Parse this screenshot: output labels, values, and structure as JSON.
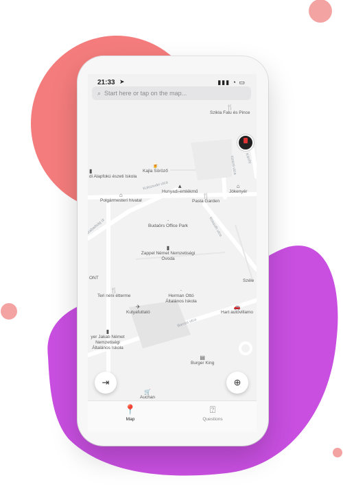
{
  "colors": {
    "coral": "#f47c7c",
    "coral_dot": "#f4a3a3",
    "purple": "#c84fe0",
    "accent": "#222222"
  },
  "status_bar": {
    "time": "21:33",
    "icons": [
      "location-arrow",
      "signal",
      "wifi",
      "battery"
    ]
  },
  "search": {
    "placeholder": "Start here or tap on the map..."
  },
  "map": {
    "pois": [
      {
        "name": "Szikla Falu és Pince",
        "icon": "restaurant-icon"
      },
      {
        "name": "Kajla Söröző",
        "icon": "bar-icon"
      },
      {
        "name": "di Alapfokú észeti Iskola",
        "icon": "school-icon"
      },
      {
        "name": "Hunyadi-emlékmű",
        "icon": "monument-icon"
      },
      {
        "name": "Jókenyér",
        "icon": "bakery-icon"
      },
      {
        "name": "Polgármesteri hivatal",
        "icon": "townhall-icon"
      },
      {
        "name": "Pasta Garden",
        "icon": "restaurant-icon"
      },
      {
        "name": "Budaörs Office Park",
        "icon": "dot-icon"
      },
      {
        "name": "Zappel Német Nemzetiségi Óvoda",
        "icon": "school-icon"
      },
      {
        "name": "Széle",
        "icon": ""
      },
      {
        "name": "ONT",
        "icon": ""
      },
      {
        "name": "Teri néni étterme",
        "icon": "restaurant-icon"
      },
      {
        "name": "Herman Ottó Általános Iskola",
        "icon": "dot-icon"
      },
      {
        "name": "Hart autóvillamo",
        "icon": "car-icon"
      },
      {
        "name": "Kutyafuttató",
        "icon": "dog-icon"
      },
      {
        "name": "yer Jakab Német Nemzetiségi Általános Iskola",
        "icon": "school-icon"
      },
      {
        "name": "Burger King",
        "icon": "fastfood-icon"
      },
      {
        "name": "Auchan",
        "icon": "cart-icon"
      }
    ],
    "streets": [
      "Szabadság út",
      "Kolozsvári utca",
      "Kossuth utca",
      "Kinizsi utca",
      "Károly",
      "Baross utca",
      "Kolozsvár"
    ]
  },
  "tabs": [
    {
      "label": "Map",
      "icon": "map-pin-icon",
      "active": true
    },
    {
      "label": "Questions",
      "icon": "question-icon",
      "active": false
    }
  ]
}
